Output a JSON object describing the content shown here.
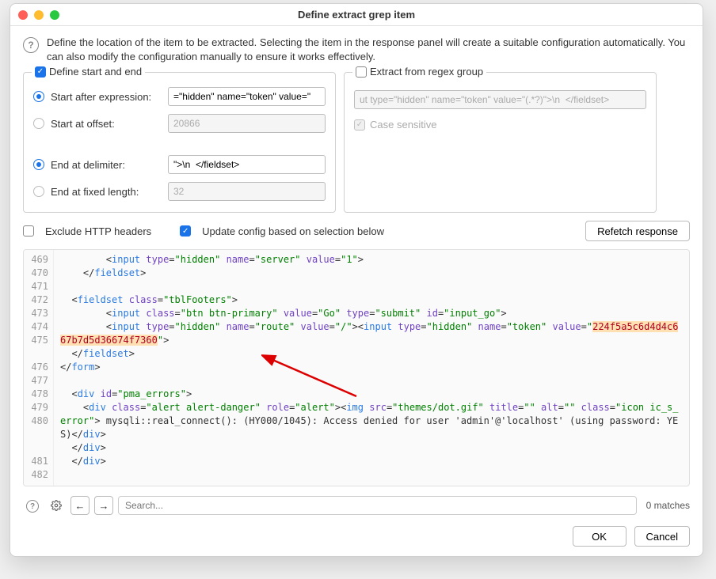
{
  "window": {
    "title": "Define extract grep item"
  },
  "description": "Define the location of the item to be extracted. Selecting the item in the response panel will create a suitable configuration automatically. You can also modify the configuration manually to ensure it works effectively.",
  "leftPanel": {
    "title": "Define start and end",
    "checked": true,
    "startAfterExpr": {
      "label": "Start after expression:",
      "selected": true,
      "value": "=\"hidden\" name=\"token\" value=\""
    },
    "startAtOffset": {
      "label": "Start at offset:",
      "selected": false,
      "value": "20866"
    },
    "endAtDelimiter": {
      "label": "End at delimiter:",
      "selected": true,
      "value": "\">\\n  </fieldset>"
    },
    "endAtFixedLength": {
      "label": "End at fixed length:",
      "selected": false,
      "value": "32"
    }
  },
  "rightPanel": {
    "title": "Extract from regex group",
    "checked": false,
    "regex": "ut type=\"hidden\" name=\"token\" value=\"(.*?)\">\\n  </fieldset>",
    "caseSensitive": {
      "label": "Case sensitive",
      "checked": true
    }
  },
  "options": {
    "excludeHeaders": {
      "label": "Exclude HTTP headers",
      "checked": false
    },
    "updateConfig": {
      "label": "Update config based on selection below",
      "checked": true
    },
    "refetch": "Refetch response"
  },
  "code": {
    "lines": [
      "469",
      "470",
      "471",
      "472",
      "473",
      "474",
      "475",
      "",
      "476",
      "477",
      "478",
      "479",
      "480",
      "",
      "",
      "481",
      "482"
    ],
    "highlighted_token": "224f5a5c6d4d4c667b7d5d36674f7360",
    "html_preview": "<input type=\"hidden\" name=\"server\" value=\"1\">\n</fieldset>\n\n<fieldset class=\"tblFooters\">\n  <input class=\"btn btn-primary\" value=\"Go\" type=\"submit\" id=\"input_go\">\n  <input type=\"hidden\" name=\"route\" value=\"/\"><input type=\"hidden\" name=\"token\" value=\"224f5a5c6d4d4c667b7d5d36674f7360\">\n</fieldset>\n</form>\n\n<div id=\"pma_errors\">\n  <div class=\"alert alert-danger\" role=\"alert\"><img src=\"themes/dot.gif\" title=\"\" alt=\"\" class=\"icon ic_s_error\"> mysqli::real_connect(): (HY000/1045): Access denied for user 'admin'@'localhost' (using password: YES)</div>\n</div>\n</div>"
  },
  "search": {
    "placeholder": "Search...",
    "matches": "0 matches"
  },
  "footer": {
    "ok": "OK",
    "cancel": "Cancel"
  }
}
